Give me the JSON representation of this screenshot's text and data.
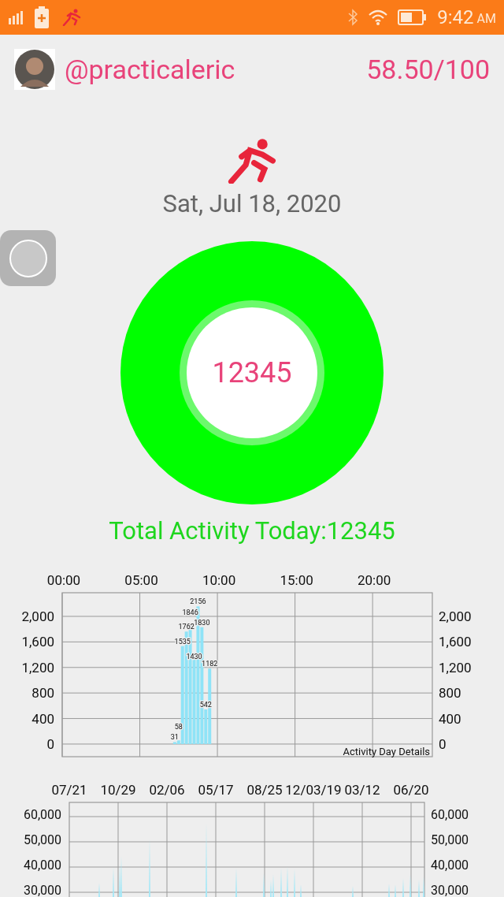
{
  "status_bar": {
    "time": "9:42",
    "period": "AM"
  },
  "header": {
    "username": "@practicaleric",
    "score": "58.50/100"
  },
  "date": "Sat, Jul 18, 2020",
  "ring": {
    "value": "12345"
  },
  "total": "Total Activity Today:12345",
  "day_chart": {
    "caption": "Activity Day Details",
    "chart_data": {
      "type": "bar",
      "x": [
        7.25,
        7.5,
        7.75,
        8,
        8.25,
        8.5,
        8.75,
        9,
        9.25,
        9.5
      ],
      "grid": true,
      "series": [
        {
          "color": "#8fe3f7",
          "values": [
            31,
            58,
            1535,
            1762,
            1846,
            1430,
            2156,
            1830,
            542,
            1182
          ]
        }
      ],
      "xlim": [
        0,
        23.85
      ],
      "ylim": [
        -198,
        2370
      ],
      "xticks": [
        {
          "value": 0,
          "label": "00:00"
        },
        {
          "value": 5,
          "label": "05:00"
        },
        {
          "value": 10,
          "label": "10:00"
        },
        {
          "value": 15,
          "label": "15:00"
        },
        {
          "value": 20,
          "label": "20:00"
        }
      ],
      "yticks": [
        {
          "value": 0,
          "label": "0"
        },
        {
          "value": 400,
          "label": "400"
        },
        {
          "value": 800,
          "label": "800"
        },
        {
          "value": 1200,
          "label": "1,200"
        },
        {
          "value": 1600,
          "label": "1,600"
        },
        {
          "value": 2000,
          "label": "2,000"
        }
      ],
      "data_labels": true
    }
  },
  "history_chart": {
    "x_labels": [
      "07/21",
      "10/29",
      "02/06",
      "05/17",
      "08/25",
      "12/03/19",
      "03/12",
      "06/20"
    ],
    "left_y_labels": [
      "60,000",
      "50,000",
      "40,000",
      "30,000"
    ],
    "right_y_labels": [
      "60,000",
      "50,000",
      "40,000",
      "30,000"
    ]
  }
}
